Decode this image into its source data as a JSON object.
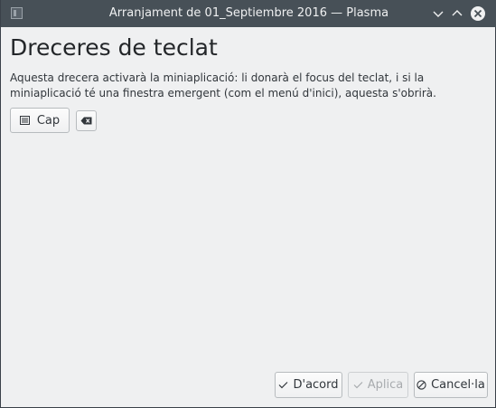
{
  "window": {
    "title": "Arranjament de 01_Septiembre 2016 — Plasma",
    "controls": {
      "minimize_icon": "chevron-down-icon",
      "maximize_icon": "chevron-up-icon",
      "close_icon": "close-circle-icon"
    }
  },
  "page": {
    "heading": "Dreceres de teclat",
    "description": "Aquesta drecera activarà la miniaplicació: li donarà el focus del teclat, i si la miniaplicació té una finestra emergent (com el menú d'inici), aquesta s'obrirà.",
    "shortcut_button_label": "Cap",
    "shortcut_icon": "keyboard-icon",
    "clear_icon": "edit-clear-icon"
  },
  "buttons": {
    "ok_label": "D'acord",
    "apply_label": "Aplica",
    "cancel_label": "Cancel·la"
  },
  "colors": {
    "titlebar": "#475057",
    "window_bg": "#eff0f1",
    "text": "#31363b",
    "disabled_text": "#a8abae"
  }
}
